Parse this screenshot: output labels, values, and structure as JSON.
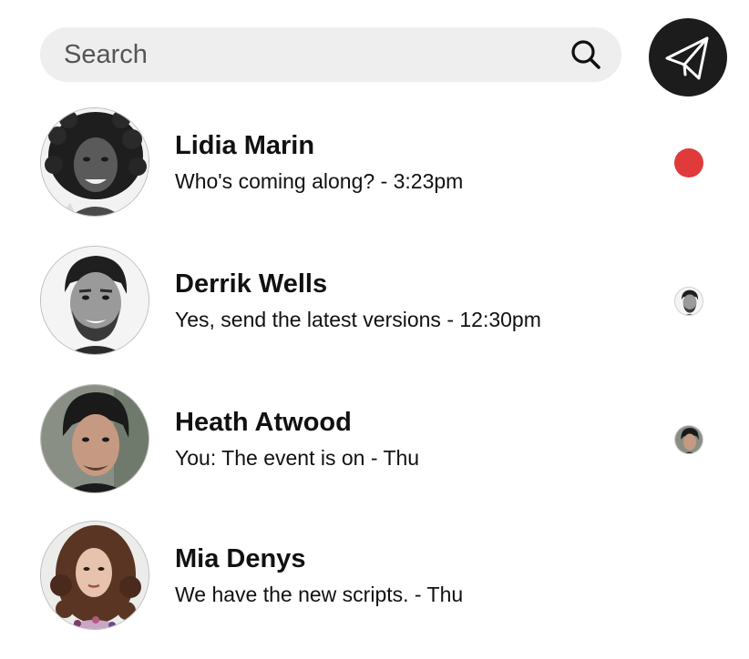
{
  "search": {
    "placeholder": "Search",
    "value": "",
    "icon": "search-icon"
  },
  "compose": {
    "icon": "paper-plane-icon",
    "background": "#1c1c1c"
  },
  "colors": {
    "unread": "#e03a3a",
    "search_bg": "#eeeeee",
    "text": "#111111"
  },
  "conversations": [
    {
      "name": "Lidia Marin",
      "message": "Who's coming along? - 3:23pm",
      "status": "unread"
    },
    {
      "name": "Derrik Wells",
      "message": "Yes, send the latest versions - 12:30pm",
      "status": "seen"
    },
    {
      "name": "Heath Atwood",
      "message": "You: The event is on - Thu",
      "status": "seen"
    },
    {
      "name": "Mia Denys",
      "message": "We have the new scripts. - Thu",
      "status": "none"
    }
  ]
}
